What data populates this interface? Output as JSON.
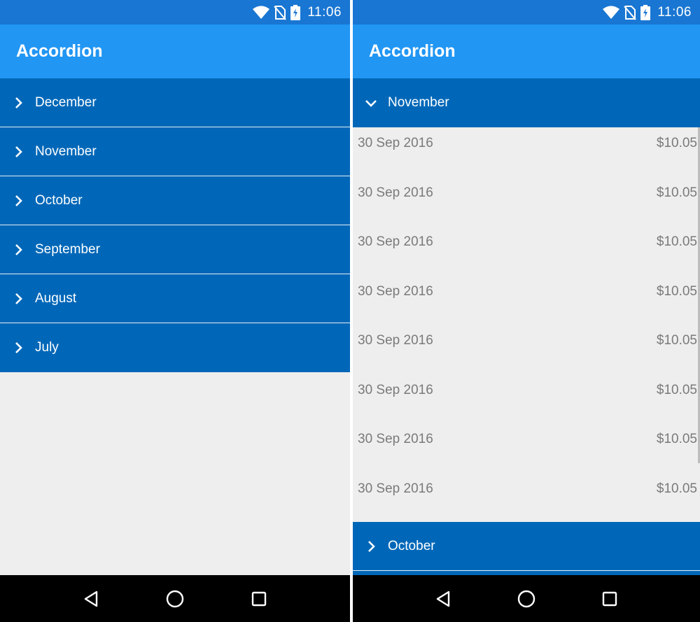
{
  "status": {
    "time": "11:06"
  },
  "left": {
    "title": "Accordion",
    "sections": [
      {
        "label": "December"
      },
      {
        "label": "November"
      },
      {
        "label": "October"
      },
      {
        "label": "September"
      },
      {
        "label": "August"
      },
      {
        "label": "July"
      }
    ]
  },
  "right": {
    "title": "Accordion",
    "expanded": {
      "label": "November",
      "rows": [
        {
          "date": "30 Sep 2016",
          "amount": "$10.05"
        },
        {
          "date": "30 Sep 2016",
          "amount": "$10.05"
        },
        {
          "date": "30 Sep 2016",
          "amount": "$10.05"
        },
        {
          "date": "30 Sep 2016",
          "amount": "$10.05"
        },
        {
          "date": "30 Sep 2016",
          "amount": "$10.05"
        },
        {
          "date": "30 Sep 2016",
          "amount": "$10.05"
        },
        {
          "date": "30 Sep 2016",
          "amount": "$10.05"
        },
        {
          "date": "30 Sep 2016",
          "amount": "$10.05"
        }
      ]
    },
    "next_section": {
      "label": "October"
    }
  },
  "colors": {
    "statusbar": "#1976d2",
    "appbar": "#2196f3",
    "section_header": "#0067b8",
    "background": "#eeeeee",
    "row_text": "#7a7a7a"
  },
  "icons": {
    "status": [
      "wifi-icon",
      "no-sim-icon",
      "battery-charging-icon"
    ],
    "nav": [
      "back-icon",
      "home-icon",
      "recents-icon"
    ],
    "collapsed": "chevron-right-icon",
    "expanded": "chevron-down-icon"
  }
}
